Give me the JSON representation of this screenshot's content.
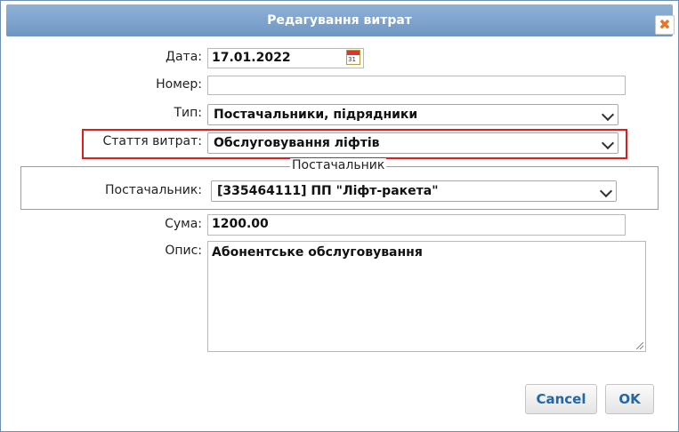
{
  "dialog": {
    "title": "Редагування витрат",
    "close_icon": "close-icon"
  },
  "form": {
    "date": {
      "label": "Дата:",
      "value": "17.01.2022",
      "icon": "calendar-icon"
    },
    "number": {
      "label": "Номер:",
      "value": ""
    },
    "type": {
      "label": "Тип:",
      "value": "Постачальники, підрядники"
    },
    "expense_item": {
      "label": "Стаття витрат:",
      "value": "Обслуговування ліфтів"
    },
    "supplier_group": {
      "legend": "Постачальник"
    },
    "supplier": {
      "label": "Постачальник:",
      "value": "[335464111] ПП \"Ліфт-ракета\""
    },
    "sum": {
      "label": "Сума:",
      "value": "1200.00"
    },
    "description": {
      "label": "Опис:",
      "value": "Абонентське обслуговування"
    }
  },
  "buttons": {
    "cancel": "Cancel",
    "ok": "OK"
  },
  "colors": {
    "titlebar": "#7ea3cf",
    "highlight": "#e31b1b",
    "button_text": "#2266a8"
  }
}
